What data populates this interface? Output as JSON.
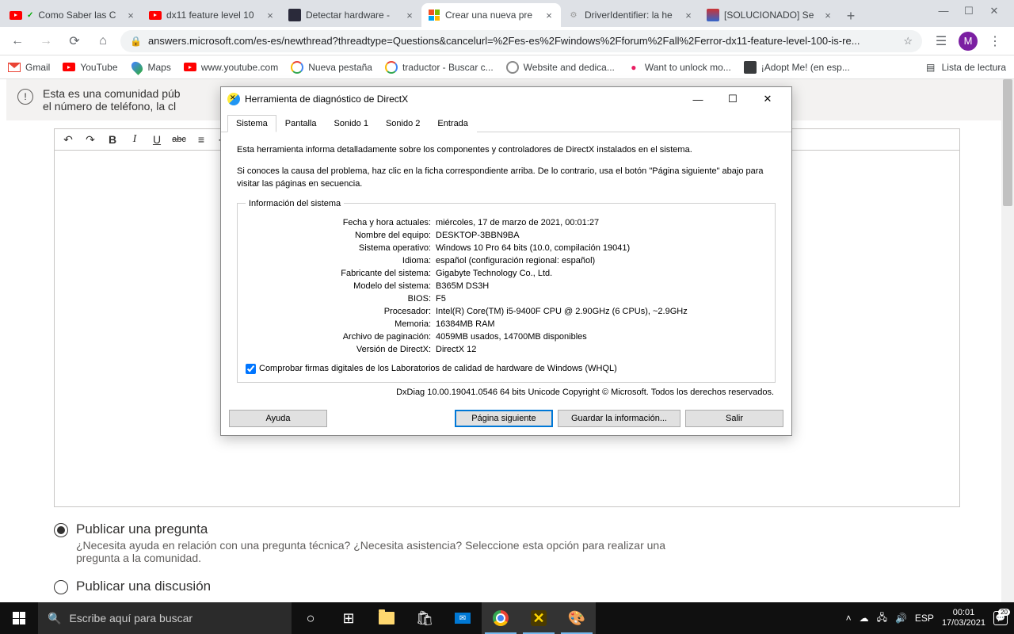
{
  "browser": {
    "tabs": [
      {
        "title": "Como Saber las C",
        "favicon": "yt"
      },
      {
        "title": "dx11 feature level 10",
        "favicon": "yt"
      },
      {
        "title": "Detectar hardware -",
        "favicon": "dark"
      },
      {
        "title": "Crear una nueva pre",
        "favicon": "ms",
        "active": true
      },
      {
        "title": "DriverIdentifier: la he",
        "favicon": "gear"
      },
      {
        "title": "[SOLUCIONADO] Se",
        "favicon": "flag"
      }
    ],
    "url": "answers.microsoft.com/es-es/newthread?threadtype=Questions&cancelurl=%2Fes-es%2Fwindows%2Fforum%2Fall%2Ferror-dx11-feature-level-100-is-re...",
    "avatar": "M"
  },
  "bookmarks": {
    "items": [
      {
        "label": "Gmail",
        "icon": "gm"
      },
      {
        "label": "YouTube",
        "icon": "yt"
      },
      {
        "label": "Maps",
        "icon": "maps"
      },
      {
        "label": "www.youtube.com",
        "icon": "yt"
      },
      {
        "label": "Nueva pestaña",
        "icon": "g"
      },
      {
        "label": "traductor - Buscar c...",
        "icon": "g"
      },
      {
        "label": "Website and dedica...",
        "icon": "g"
      },
      {
        "label": "Want to unlock mo...",
        "icon": "dot"
      },
      {
        "label": "¡Adopt Me! (en esp...",
        "icon": "rbx"
      }
    ],
    "reading_list": "Lista de lectura"
  },
  "page": {
    "notice": "Esta es una comunidad púb\nel número de teléfono, la cl",
    "radio1_label": "Publicar una pregunta",
    "radio1_desc": "¿Necesita ayuda en relación con una pregunta técnica? ¿Necesita asistencia? Seleccione esta opción para realizar una pregunta a la comunidad.",
    "radio2_label": "Publicar una discusión"
  },
  "dxdiag": {
    "title": "Herramienta de diagnóstico de DirectX",
    "tabs": [
      "Sistema",
      "Pantalla",
      "Sonido 1",
      "Sonido 2",
      "Entrada"
    ],
    "intro1": "Esta herramienta informa detalladamente sobre los componentes y controladores de DirectX instalados en el sistema.",
    "intro2": "Si conoces la causa del problema, haz clic en la ficha correspondiente arriba. De lo contrario, usa el botón \"Página siguiente\" abajo para visitar las páginas en secuencia.",
    "legend": "Información del sistema",
    "rows": [
      {
        "k": "Fecha y hora actuales:",
        "v": "miércoles, 17 de marzo de 2021, 00:01:27"
      },
      {
        "k": "Nombre del equipo:",
        "v": "DESKTOP-3BBN9BA"
      },
      {
        "k": "Sistema operativo:",
        "v": "Windows 10 Pro 64 bits (10.0, compilación 19041)"
      },
      {
        "k": "Idioma:",
        "v": "español (configuración regional: español)"
      },
      {
        "k": "Fabricante del sistema:",
        "v": "Gigabyte Technology Co., Ltd."
      },
      {
        "k": "Modelo del sistema:",
        "v": "B365M DS3H"
      },
      {
        "k": "BIOS:",
        "v": "F5"
      },
      {
        "k": "Procesador:",
        "v": "Intel(R) Core(TM) i5-9400F CPU @ 2.90GHz (6 CPUs), ~2.9GHz"
      },
      {
        "k": "Memoria:",
        "v": "16384MB RAM"
      },
      {
        "k": "Archivo de paginación:",
        "v": "4059MB usados, 14700MB disponibles"
      },
      {
        "k": "Versión de DirectX:",
        "v": "DirectX 12"
      }
    ],
    "checkbox": "Comprobar firmas digitales de los Laboratorios de calidad de hardware de Windows (WHQL)",
    "footer": "DxDiag 10.00.19041.0546 64 bits Unicode  Copyright © Microsoft. Todos los derechos reservados.",
    "btn_help": "Ayuda",
    "btn_next": "Página siguiente",
    "btn_save": "Guardar la información...",
    "btn_exit": "Salir"
  },
  "taskbar": {
    "search_placeholder": "Escribe aquí para buscar",
    "lang": "ESP",
    "time": "00:01",
    "date": "17/03/2021",
    "notif_count": "20"
  }
}
